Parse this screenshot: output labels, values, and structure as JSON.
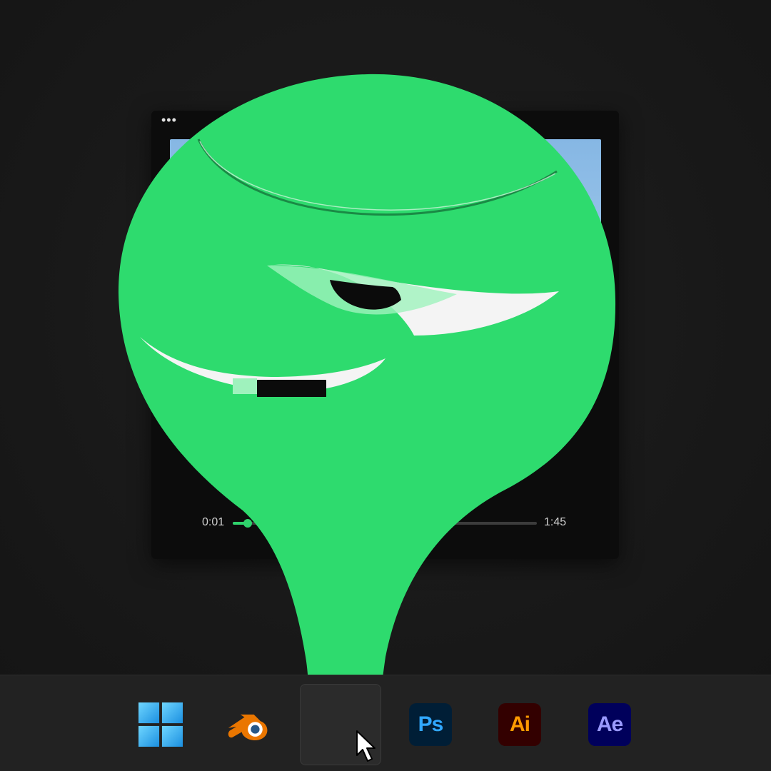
{
  "player": {
    "menu_icon": "more-dots-icon",
    "time_current": "0:01",
    "time_total": "1:45",
    "progress": 0.05
  },
  "colors": {
    "accent": "#2fd36c",
    "mascot_green": "#2edb6e",
    "taskbar": "#222222"
  },
  "taskbar": {
    "items": [
      {
        "name": "windows-start",
        "icon": "windows-logo-icon"
      },
      {
        "name": "blender",
        "icon": "blender-icon"
      },
      {
        "name": "active-app",
        "icon": "blank-app-slot"
      },
      {
        "name": "photoshop",
        "icon": "photoshop-icon",
        "label": "Ps"
      },
      {
        "name": "illustrator",
        "icon": "illustrator-icon",
        "label": "Ai"
      },
      {
        "name": "after-effects",
        "icon": "after-effects-icon",
        "label": "Ae"
      }
    ]
  },
  "cursor": {
    "icon": "mouse-pointer-icon"
  }
}
